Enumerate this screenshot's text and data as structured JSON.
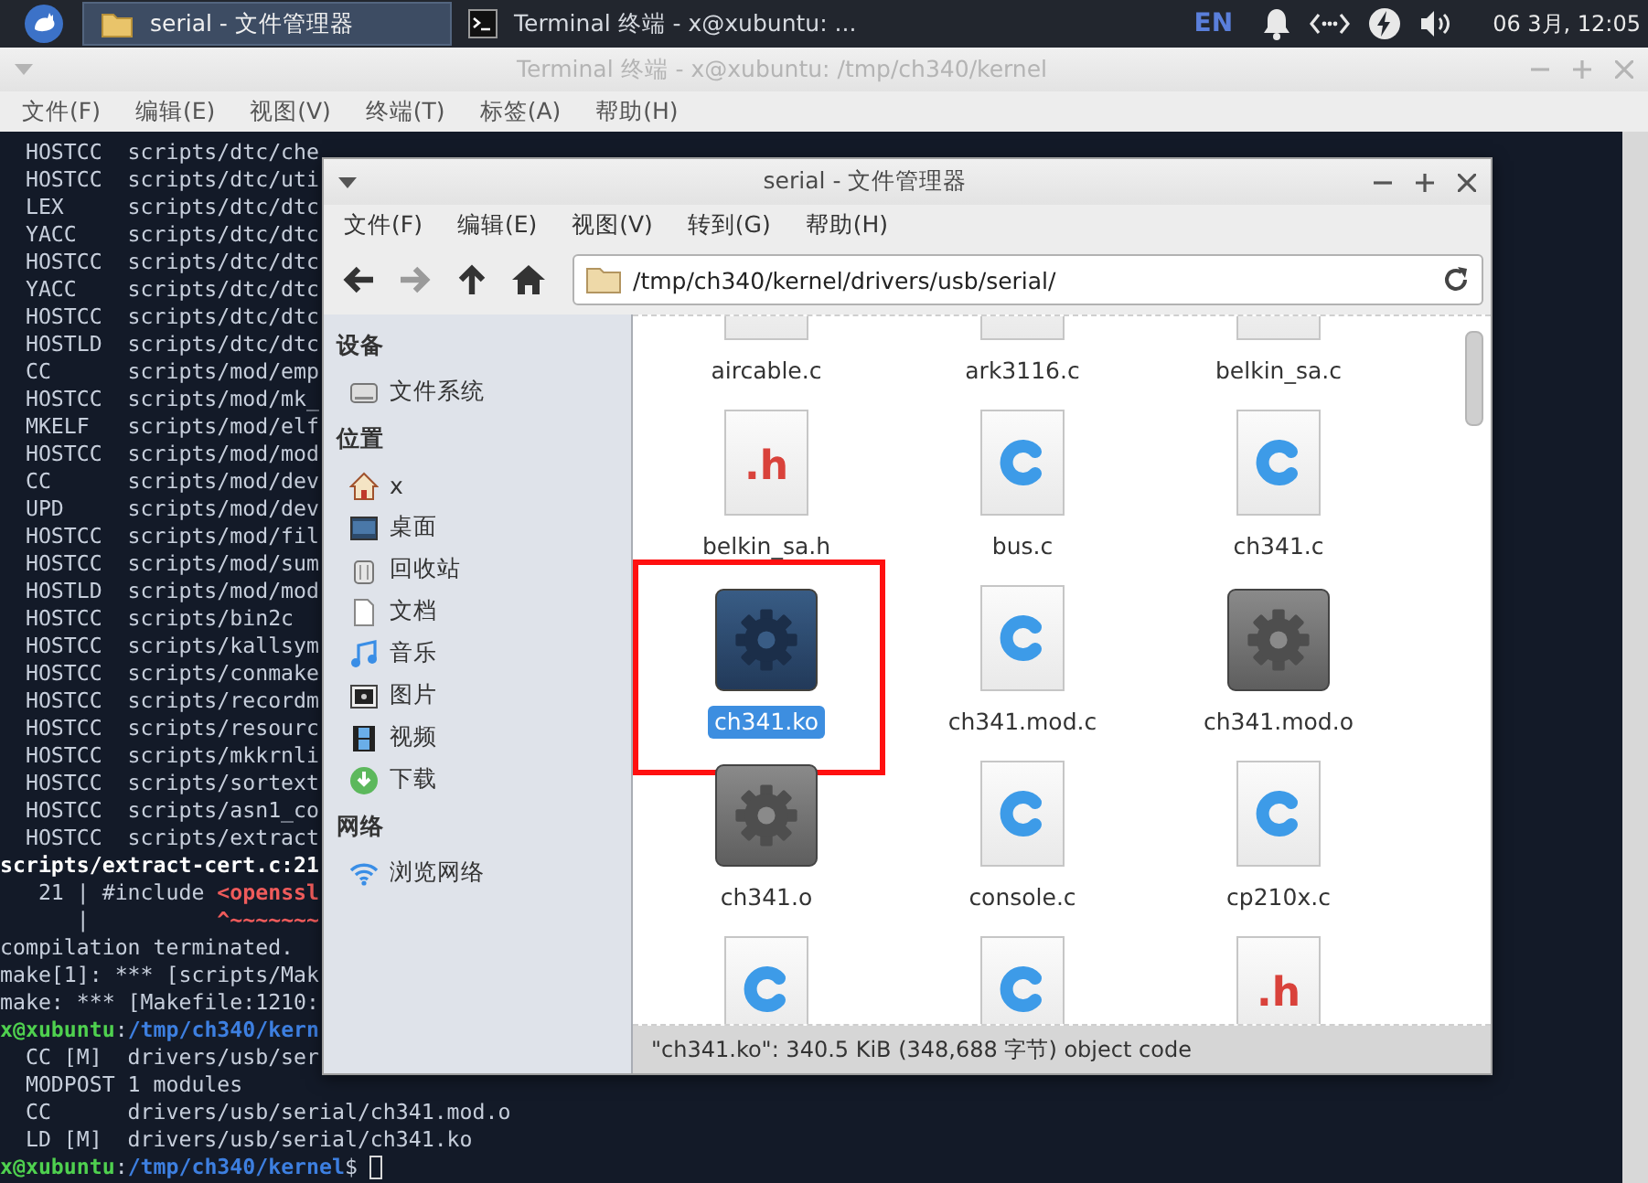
{
  "panel": {
    "tasks": [
      {
        "title": "serial - 文件管理器",
        "kind": "folder",
        "selected": true
      },
      {
        "title": "Terminal 终端 - x@xubuntu: ...",
        "kind": "terminal",
        "selected": false
      }
    ],
    "keyboard_layout": "EN",
    "clock": "06 3月, 12:05"
  },
  "terminal": {
    "title": "Terminal 终端 - x@xubuntu: /tmp/ch340/kernel",
    "menu": [
      "文件(F)",
      "编辑(E)",
      "视图(V)",
      "终端(T)",
      "标签(A)",
      "帮助(H)"
    ],
    "cursor": true,
    "lines": [
      {
        "parts": [
          {
            "text": "  HOSTCC  scripts/dtc/che",
            "kind": "plain"
          }
        ]
      },
      {
        "parts": [
          {
            "text": "  HOSTCC  scripts/dtc/uti",
            "kind": "plain"
          }
        ]
      },
      {
        "parts": [
          {
            "text": "  LEX     scripts/dtc/dtc",
            "kind": "plain"
          }
        ]
      },
      {
        "parts": [
          {
            "text": "  YACC    scripts/dtc/dtc",
            "kind": "plain"
          }
        ]
      },
      {
        "parts": [
          {
            "text": "  HOSTCC  scripts/dtc/dtc",
            "kind": "plain"
          }
        ]
      },
      {
        "parts": [
          {
            "text": "  YACC    scripts/dtc/dtc",
            "kind": "plain"
          }
        ]
      },
      {
        "parts": [
          {
            "text": "  HOSTCC  scripts/dtc/dtc",
            "kind": "plain"
          }
        ]
      },
      {
        "parts": [
          {
            "text": "  HOSTLD  scripts/dtc/dtc",
            "kind": "plain"
          }
        ]
      },
      {
        "parts": [
          {
            "text": "  CC      scripts/mod/emp",
            "kind": "plain"
          }
        ]
      },
      {
        "parts": [
          {
            "text": "  HOSTCC  scripts/mod/mk_",
            "kind": "plain"
          }
        ]
      },
      {
        "parts": [
          {
            "text": "  MKELF   scripts/mod/elf",
            "kind": "plain"
          }
        ]
      },
      {
        "parts": [
          {
            "text": "  HOSTCC  scripts/mod/mod",
            "kind": "plain"
          }
        ]
      },
      {
        "parts": [
          {
            "text": "  CC      scripts/mod/dev",
            "kind": "plain"
          }
        ]
      },
      {
        "parts": [
          {
            "text": "  UPD     scripts/mod/dev",
            "kind": "plain"
          }
        ]
      },
      {
        "parts": [
          {
            "text": "  HOSTCC  scripts/mod/fil",
            "kind": "plain"
          }
        ]
      },
      {
        "parts": [
          {
            "text": "  HOSTCC  scripts/mod/sum",
            "kind": "plain"
          }
        ]
      },
      {
        "parts": [
          {
            "text": "  HOSTLD  scripts/mod/mod",
            "kind": "plain"
          }
        ]
      },
      {
        "parts": [
          {
            "text": "  HOSTCC  scripts/bin2c",
            "kind": "plain"
          }
        ]
      },
      {
        "parts": [
          {
            "text": "  HOSTCC  scripts/kallsym",
            "kind": "plain"
          }
        ]
      },
      {
        "parts": [
          {
            "text": "  HOSTCC  scripts/conmake",
            "kind": "plain"
          }
        ]
      },
      {
        "parts": [
          {
            "text": "  HOSTCC  scripts/recordm",
            "kind": "plain"
          }
        ]
      },
      {
        "parts": [
          {
            "text": "  HOSTCC  scripts/resourc",
            "kind": "plain"
          }
        ]
      },
      {
        "parts": [
          {
            "text": "  HOSTCC  scripts/mkkrnli",
            "kind": "plain"
          }
        ]
      },
      {
        "parts": [
          {
            "text": "  HOSTCC  scripts/sortext",
            "kind": "plain"
          }
        ]
      },
      {
        "parts": [
          {
            "text": "  HOSTCC  scripts/asn1_co",
            "kind": "plain"
          }
        ]
      },
      {
        "parts": [
          {
            "text": "  HOSTCC  scripts/extract",
            "kind": "plain"
          }
        ]
      },
      {
        "parts": [
          {
            "text": "scripts/extract-cert.c:21",
            "kind": "bold"
          }
        ]
      },
      {
        "parts": [
          {
            "text": "   21 | #include ",
            "kind": "plain"
          },
          {
            "text": "<openssl",
            "kind": "error"
          }
        ]
      },
      {
        "parts": [
          {
            "text": "      |          ",
            "kind": "plain"
          },
          {
            "text": "^~~~~~~~",
            "kind": "error"
          }
        ]
      },
      {
        "parts": [
          {
            "text": "compilation terminated.",
            "kind": "plain"
          }
        ]
      },
      {
        "parts": [
          {
            "text": "make[1]: *** [scripts/Mak",
            "kind": "plain"
          }
        ]
      },
      {
        "parts": [
          {
            "text": "make: *** [Makefile:1210:",
            "kind": "plain"
          }
        ]
      },
      {
        "parts": [
          {
            "text": "x@xubuntu",
            "kind": "prompt"
          },
          {
            "text": ":",
            "kind": "plain"
          },
          {
            "text": "/tmp/ch340/kern",
            "kind": "path"
          }
        ]
      },
      {
        "parts": [
          {
            "text": "  CC [M]  drivers/usb/ser",
            "kind": "plain"
          }
        ]
      },
      {
        "parts": [
          {
            "text": "  MODPOST 1 modules",
            "kind": "plain"
          }
        ]
      },
      {
        "parts": [
          {
            "text": "  CC      drivers/usb/serial/ch341.mod.o",
            "kind": "plain"
          }
        ]
      },
      {
        "parts": [
          {
            "text": "  LD [M]  drivers/usb/serial/ch341.ko",
            "kind": "plain"
          }
        ]
      },
      {
        "parts": [
          {
            "text": "x@xubuntu",
            "kind": "prompt"
          },
          {
            "text": ":",
            "kind": "plain"
          },
          {
            "text": "/tmp/ch340/kernel",
            "kind": "path"
          },
          {
            "text": "$ ",
            "kind": "plain"
          }
        ]
      }
    ]
  },
  "file_manager": {
    "title": "serial - 文件管理器",
    "menu": [
      "文件(F)",
      "编辑(E)",
      "视图(V)",
      "转到(G)",
      "帮助(H)"
    ],
    "nav": [
      {
        "kind": "back",
        "disabled": false
      },
      {
        "kind": "forward",
        "disabled": true
      },
      {
        "kind": "up",
        "disabled": false
      },
      {
        "kind": "home",
        "disabled": false
      }
    ],
    "location": "/tmp/ch340/kernel/drivers/usb/serial/",
    "sidebar": [
      {
        "heading": "设备",
        "items": [
          {
            "label": "文件系统",
            "kind": "drive"
          }
        ]
      },
      {
        "heading": "位置",
        "items": [
          {
            "label": "x",
            "kind": "home"
          },
          {
            "label": "桌面",
            "kind": "desktop"
          },
          {
            "label": "回收站",
            "kind": "trash"
          },
          {
            "label": "文档",
            "kind": "document"
          },
          {
            "label": "音乐",
            "kind": "music"
          },
          {
            "label": "图片",
            "kind": "picture"
          },
          {
            "label": "视频",
            "kind": "video"
          },
          {
            "label": "下载",
            "kind": "download"
          }
        ]
      },
      {
        "heading": "网络",
        "items": [
          {
            "label": "浏览网络",
            "kind": "network"
          }
        ]
      }
    ],
    "files": [
      {
        "name": "aircable.c",
        "kind": "c",
        "selected": false,
        "marked": false
      },
      {
        "name": "ark3116.c",
        "kind": "c",
        "selected": false,
        "marked": false
      },
      {
        "name": "belkin_sa.c",
        "kind": "c",
        "selected": false,
        "marked": false
      },
      {
        "name": "belkin_sa.h",
        "kind": "h",
        "glyph": ".h",
        "selected": false,
        "marked": false
      },
      {
        "name": "bus.c",
        "kind": "c",
        "selected": false,
        "marked": false
      },
      {
        "name": "ch341.c",
        "kind": "c",
        "selected": false,
        "marked": false
      },
      {
        "name": "ch341.ko",
        "kind": "binary",
        "selected": true,
        "marked": true
      },
      {
        "name": "ch341.mod.c",
        "kind": "c",
        "selected": false,
        "marked": false
      },
      {
        "name": "ch341.mod.o",
        "kind": "binary",
        "selected": false,
        "marked": false
      },
      {
        "name": "ch341.o",
        "kind": "binary",
        "selected": false,
        "marked": false
      },
      {
        "name": "console.c",
        "kind": "c",
        "selected": false,
        "marked": false
      },
      {
        "name": "cp210x.c",
        "kind": "c",
        "selected": false,
        "marked": false
      },
      {
        "kind": "c",
        "selected": false,
        "marked": false
      },
      {
        "kind": "c",
        "selected": false,
        "marked": false
      },
      {
        "kind": "h",
        "glyph": ".h",
        "selected": false,
        "marked": false
      }
    ],
    "status": "\"ch341.ko\": 340.5 KiB (348,688 字节) object code"
  }
}
